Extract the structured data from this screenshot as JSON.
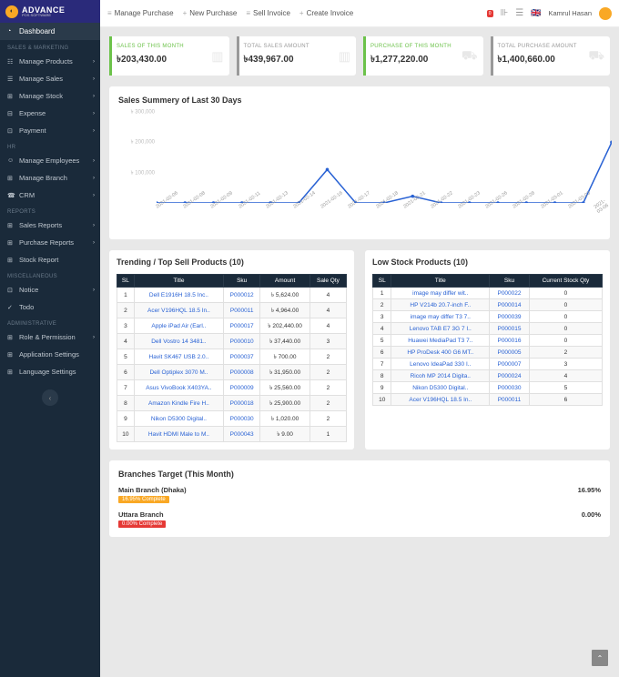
{
  "brand": {
    "name": "ADVANCE",
    "sub": "POS SOFTWARE"
  },
  "topbar": {
    "links": [
      {
        "label": "Manage Purchase",
        "icon": "≡"
      },
      {
        "label": "New Purchase",
        "icon": "+"
      },
      {
        "label": "Sell Invoice",
        "icon": "≡"
      },
      {
        "label": "Create Invoice",
        "icon": "+"
      }
    ],
    "notif": "0",
    "user": "Kamrul Hasan"
  },
  "sidebar": {
    "dashboard": "Dashboard",
    "sections": [
      {
        "label": "SALES & MARKETING",
        "items": [
          "Manage Products",
          "Manage Sales",
          "Manage Stock",
          "Expense",
          "Payment"
        ]
      },
      {
        "label": "HR",
        "items": [
          "Manage Employees",
          "Manage Branch",
          "CRM"
        ]
      },
      {
        "label": "REPORTS",
        "items": [
          "Sales Reports",
          "Purchase Reports",
          "Stock Report"
        ]
      },
      {
        "label": "MISCELLANEOUS",
        "items": [
          "Notice",
          "Todo"
        ]
      },
      {
        "label": "ADMINISTRATIVE",
        "items": [
          "Role & Permission",
          "Application Settings",
          "Language Settings"
        ]
      }
    ]
  },
  "cards": [
    {
      "label": "SALES OF THIS MONTH",
      "value": "৳203,430.00",
      "color": "#6cc24a",
      "icon": "bar"
    },
    {
      "label": "TOTAL SALES AMOUNT",
      "value": "৳439,967.00",
      "color": "#999",
      "icon": "bar"
    },
    {
      "label": "PURCHASE OF THIS MONTH",
      "value": "৳1,277,220.00",
      "color": "#6cc24a",
      "icon": "truck"
    },
    {
      "label": "TOTAL PURCHASE AMOUNT",
      "value": "৳1,400,660.00",
      "color": "#999",
      "icon": "truck"
    }
  ],
  "summary_title": "Sales Summery of Last 30 Days",
  "chart_data": {
    "type": "line",
    "ylabel": "",
    "ylim": [
      0,
      300000
    ],
    "yticks": [
      "৳ 100,000",
      "৳ 200,000",
      "৳ 300,000"
    ],
    "x": [
      "2021-02-06",
      "2021-02-08",
      "2021-02-09",
      "2021-02-11",
      "2021-02-13",
      "2021-02-14",
      "2021-02-16",
      "2021-02-17",
      "2021-02-18",
      "2021-02-21",
      "2021-02-22",
      "2021-02-23",
      "2021-02-26",
      "2021-02-28",
      "2021-03-01",
      "2021-03-03",
      "2021-03-06"
    ],
    "values": [
      0,
      0,
      0,
      0,
      0,
      0,
      110000,
      0,
      0,
      22000,
      0,
      0,
      0,
      0,
      0,
      0,
      200000
    ]
  },
  "trending": {
    "title": "Trending / Top Sell Products (10)",
    "columns": [
      "SL",
      "Title",
      "Sku",
      "Amount",
      "Sale Qty"
    ],
    "rows": [
      [
        "1",
        "Dell E1916H 18.5 Inc..",
        "P000012",
        "৳ 5,624.00",
        "4"
      ],
      [
        "2",
        "Acer V196HQL 18.5 In..",
        "P000011",
        "৳ 4,964.00",
        "4"
      ],
      [
        "3",
        "Apple iPad Air (Earl..",
        "P000017",
        "৳ 202,440.00",
        "4"
      ],
      [
        "4",
        "Dell Vostro 14 3481..",
        "P000010",
        "৳ 37,440.00",
        "3"
      ],
      [
        "5",
        "Havit SK467 USB 2.0..",
        "P000037",
        "৳ 700.00",
        "2"
      ],
      [
        "6",
        "Dell Optiplex 3070 M..",
        "P000008",
        "৳ 31,950.00",
        "2"
      ],
      [
        "7",
        "Asus VivoBook X403YA..",
        "P000009",
        "৳ 25,560.00",
        "2"
      ],
      [
        "8",
        "Amazon Kindle Fire H..",
        "P000018",
        "৳ 25,900.00",
        "2"
      ],
      [
        "9",
        "Nikon D5300 Digital..",
        "P000030",
        "৳ 1,020.00",
        "2"
      ],
      [
        "10",
        "Havit HDMI Male to M..",
        "P000043",
        "৳ 9.00",
        "1"
      ]
    ]
  },
  "lowstock": {
    "title": "Low Stock Products (10)",
    "columns": [
      "SL",
      "Title",
      "Sku",
      "Current Stock Qty"
    ],
    "rows": [
      [
        "1",
        "image may differ wit..",
        "P000022",
        "0"
      ],
      [
        "2",
        "HP V214b 20.7-inch F..",
        "P000014",
        "0"
      ],
      [
        "3",
        "image may differ T3 7..",
        "P000039",
        "0"
      ],
      [
        "4",
        "Lenovo TAB E7 3G 7 I..",
        "P000015",
        "0"
      ],
      [
        "5",
        "Huawei MediaPad T3 7..",
        "P000016",
        "0"
      ],
      [
        "6",
        "HP ProDesk 400 G6 MT..",
        "P000005",
        "2"
      ],
      [
        "7",
        "Lenovo IdeaPad 330 I..",
        "P000007",
        "3"
      ],
      [
        "8",
        "Ricoh MP 2014 Digita..",
        "P000024",
        "4"
      ],
      [
        "9",
        "Nikon D5300 Digital..",
        "P000030",
        "5"
      ],
      [
        "10",
        "Acer V196HQL 18.5 In..",
        "P000011",
        "6"
      ]
    ]
  },
  "branches": {
    "title": "Branches Target (This Month)",
    "rows": [
      {
        "name": "Main Branch (Dhaka)",
        "pct": "16.95%",
        "badge": "16.95% Complete",
        "color": "#f9a825"
      },
      {
        "name": "Uttara Branch",
        "pct": "0.00%",
        "badge": "0.00% Complete",
        "color": "#e53935"
      }
    ]
  }
}
